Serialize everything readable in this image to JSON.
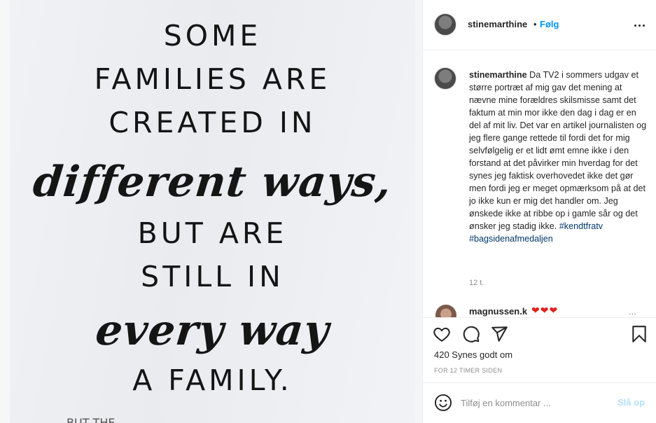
{
  "image": {
    "lines": [
      {
        "text": "SOME",
        "style": "caps"
      },
      {
        "text": "FAMILIES ARE",
        "style": "caps"
      },
      {
        "text": "CREATED IN",
        "style": "caps"
      },
      {
        "text": "different ways,",
        "style": "script"
      },
      {
        "text": "BUT ARE",
        "style": "caps"
      },
      {
        "text": "STILL IN",
        "style": "caps"
      },
      {
        "text": "every way",
        "style": "script"
      },
      {
        "text": "A FAMILY.",
        "style": "caps"
      }
    ],
    "cut_text": "BUT THE"
  },
  "header": {
    "username": "stinemarthine",
    "separator": "•",
    "follow_label": "Følg",
    "more_icon": "more-horizontal-icon"
  },
  "caption": {
    "username": "stinemarthine",
    "text": "Da TV2 i sommers udgav et større portræt af mig gav det mening at nævne mine forældres skilsmisse samt det faktum at min mor ikke den dag i dag er en del af mit liv. Det var en artikel journalisten og jeg flere gange rettede til fordi det for mig selvfølgelig er et lidt ømt emne ikke i den forstand at det påvirker min hverdag for det synes jeg faktisk overhovedet ikke det gør men fordi jeg er meget opmærksom på at det jo ikke kun er mig det handler om. Jeg ønskede ikke at ribbe op i gamle sår og det ønsker jeg stadig ikke.",
    "hashtags": "#kendtfratv #bagsidenafmedaljen",
    "time": "12 t."
  },
  "comment_preview": {
    "username": "magnussen.k",
    "hearts": "❤❤❤",
    "more": "..."
  },
  "actions": {
    "icons": [
      "heart-icon",
      "comment-icon",
      "share-icon",
      "bookmark-icon"
    ],
    "likes_text": "420 Synes godt om",
    "posted_ago": "FOR 12 TIMER SIDEN"
  },
  "comment_box": {
    "placeholder": "Tilføj en kommentar ...",
    "post_label": "Slå op"
  },
  "colors": {
    "accent": "#0095f6",
    "hashtag": "#00376b",
    "post_disabled": "#b2dffc",
    "heart": "#e0211d"
  }
}
